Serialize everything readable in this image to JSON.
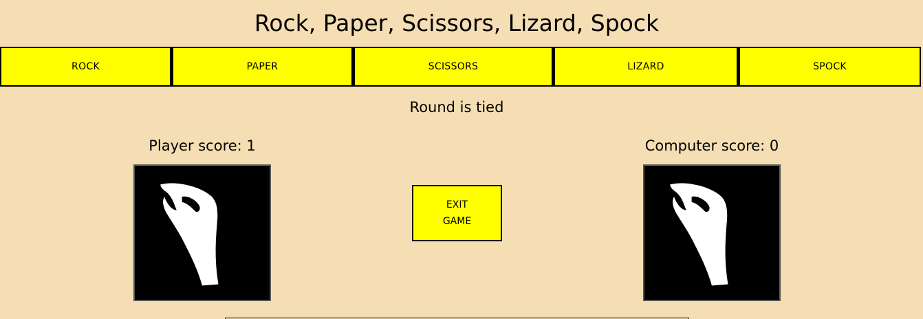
{
  "title": "Rock, Paper, Scissors, Lizard, Spock",
  "choices": [
    {
      "label": "ROCK"
    },
    {
      "label": "PAPER"
    },
    {
      "label": "SCISSORS"
    },
    {
      "label": "LIZARD"
    },
    {
      "label": "SPOCK"
    }
  ],
  "result": "Round is tied",
  "player": {
    "score_label": "Player score: 1",
    "choice_icon": "lizard-hand-icon"
  },
  "computer": {
    "score_label": "Computer score: 0",
    "choice_icon": "lizard-hand-icon"
  },
  "exit_button": {
    "line1": "EXIT",
    "line2": "GAME"
  },
  "colors": {
    "background": "#f5deb3",
    "button": "#ffff00",
    "button_border": "#000000",
    "image_background": "#000000",
    "hand": "#ffffff"
  }
}
